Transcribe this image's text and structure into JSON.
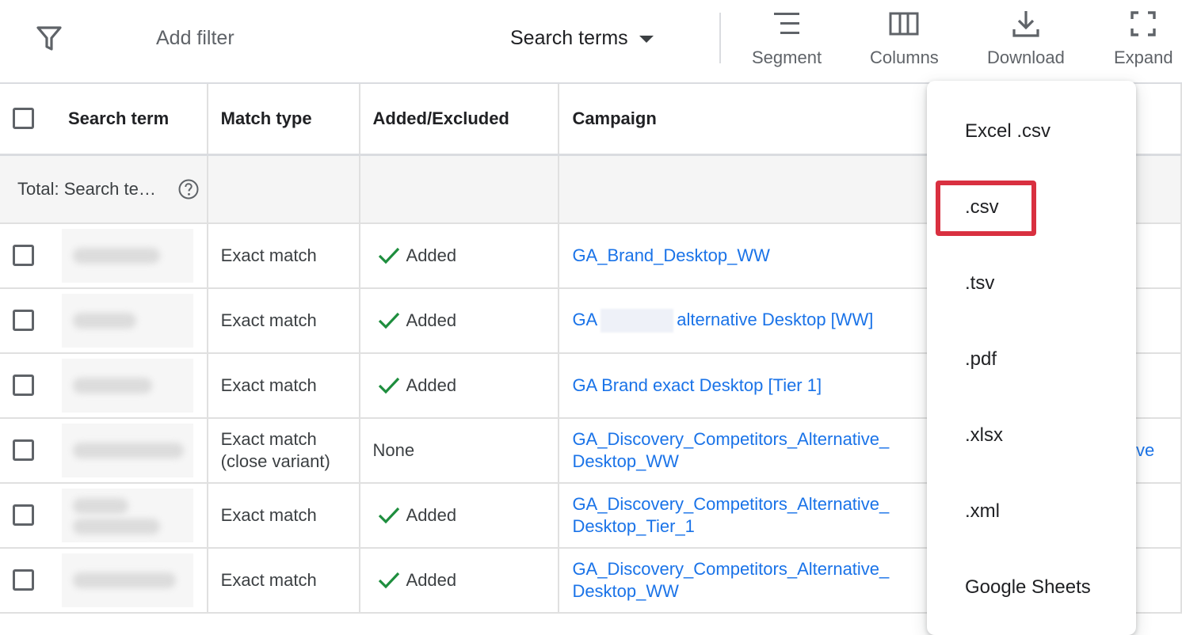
{
  "toolbar": {
    "add_filter": "Add filter",
    "view_selector": "Search terms",
    "segment": "Segment",
    "columns": "Columns",
    "download": "Download",
    "expand": "Expand"
  },
  "table": {
    "headers": [
      "Search term",
      "Match type",
      "Added/Excluded",
      "Campaign"
    ],
    "total_label": "Total: Search te…",
    "rows": [
      {
        "match_type": "Exact match",
        "status": "Added",
        "campaign": "GA_Brand_Desktop_WW"
      },
      {
        "match_type": "Exact match",
        "status": "Added",
        "campaign_prefix": "GA",
        "campaign_suffix": "alternative Desktop [WW]"
      },
      {
        "match_type": "Exact match",
        "status": "Added",
        "campaign": "GA Brand exact Desktop [Tier 1]"
      },
      {
        "match_type_line1": "Exact match",
        "match_type_line2": "(close variant)",
        "status": "None",
        "campaign_line1": "GA_Discovery_Competitors_Alternative_",
        "campaign_line2": "Desktop_WW"
      },
      {
        "match_type": "Exact match",
        "status": "Added",
        "campaign_line1": "GA_Discovery_Competitors_Alternative_",
        "campaign_line2": "Desktop_Tier_1"
      },
      {
        "match_type": "Exact match",
        "status": "Added",
        "campaign_line1": "GA_Discovery_Competitors_Alternative_",
        "campaign_line2": "Desktop_WW"
      }
    ],
    "overflow_text": "ve"
  },
  "download_menu": {
    "items": [
      "Excel .csv",
      ".csv",
      ".tsv",
      ".pdf",
      ".xlsx",
      ".xml",
      "Google Sheets"
    ]
  },
  "colors": {
    "link": "#1a73e8",
    "check": "#1e8e3e",
    "highlight": "#d93040"
  },
  "icons": [
    "filter-icon",
    "chevron-down-icon",
    "segment-icon",
    "columns-icon",
    "download-icon",
    "expand-icon",
    "help-icon",
    "check-icon"
  ]
}
